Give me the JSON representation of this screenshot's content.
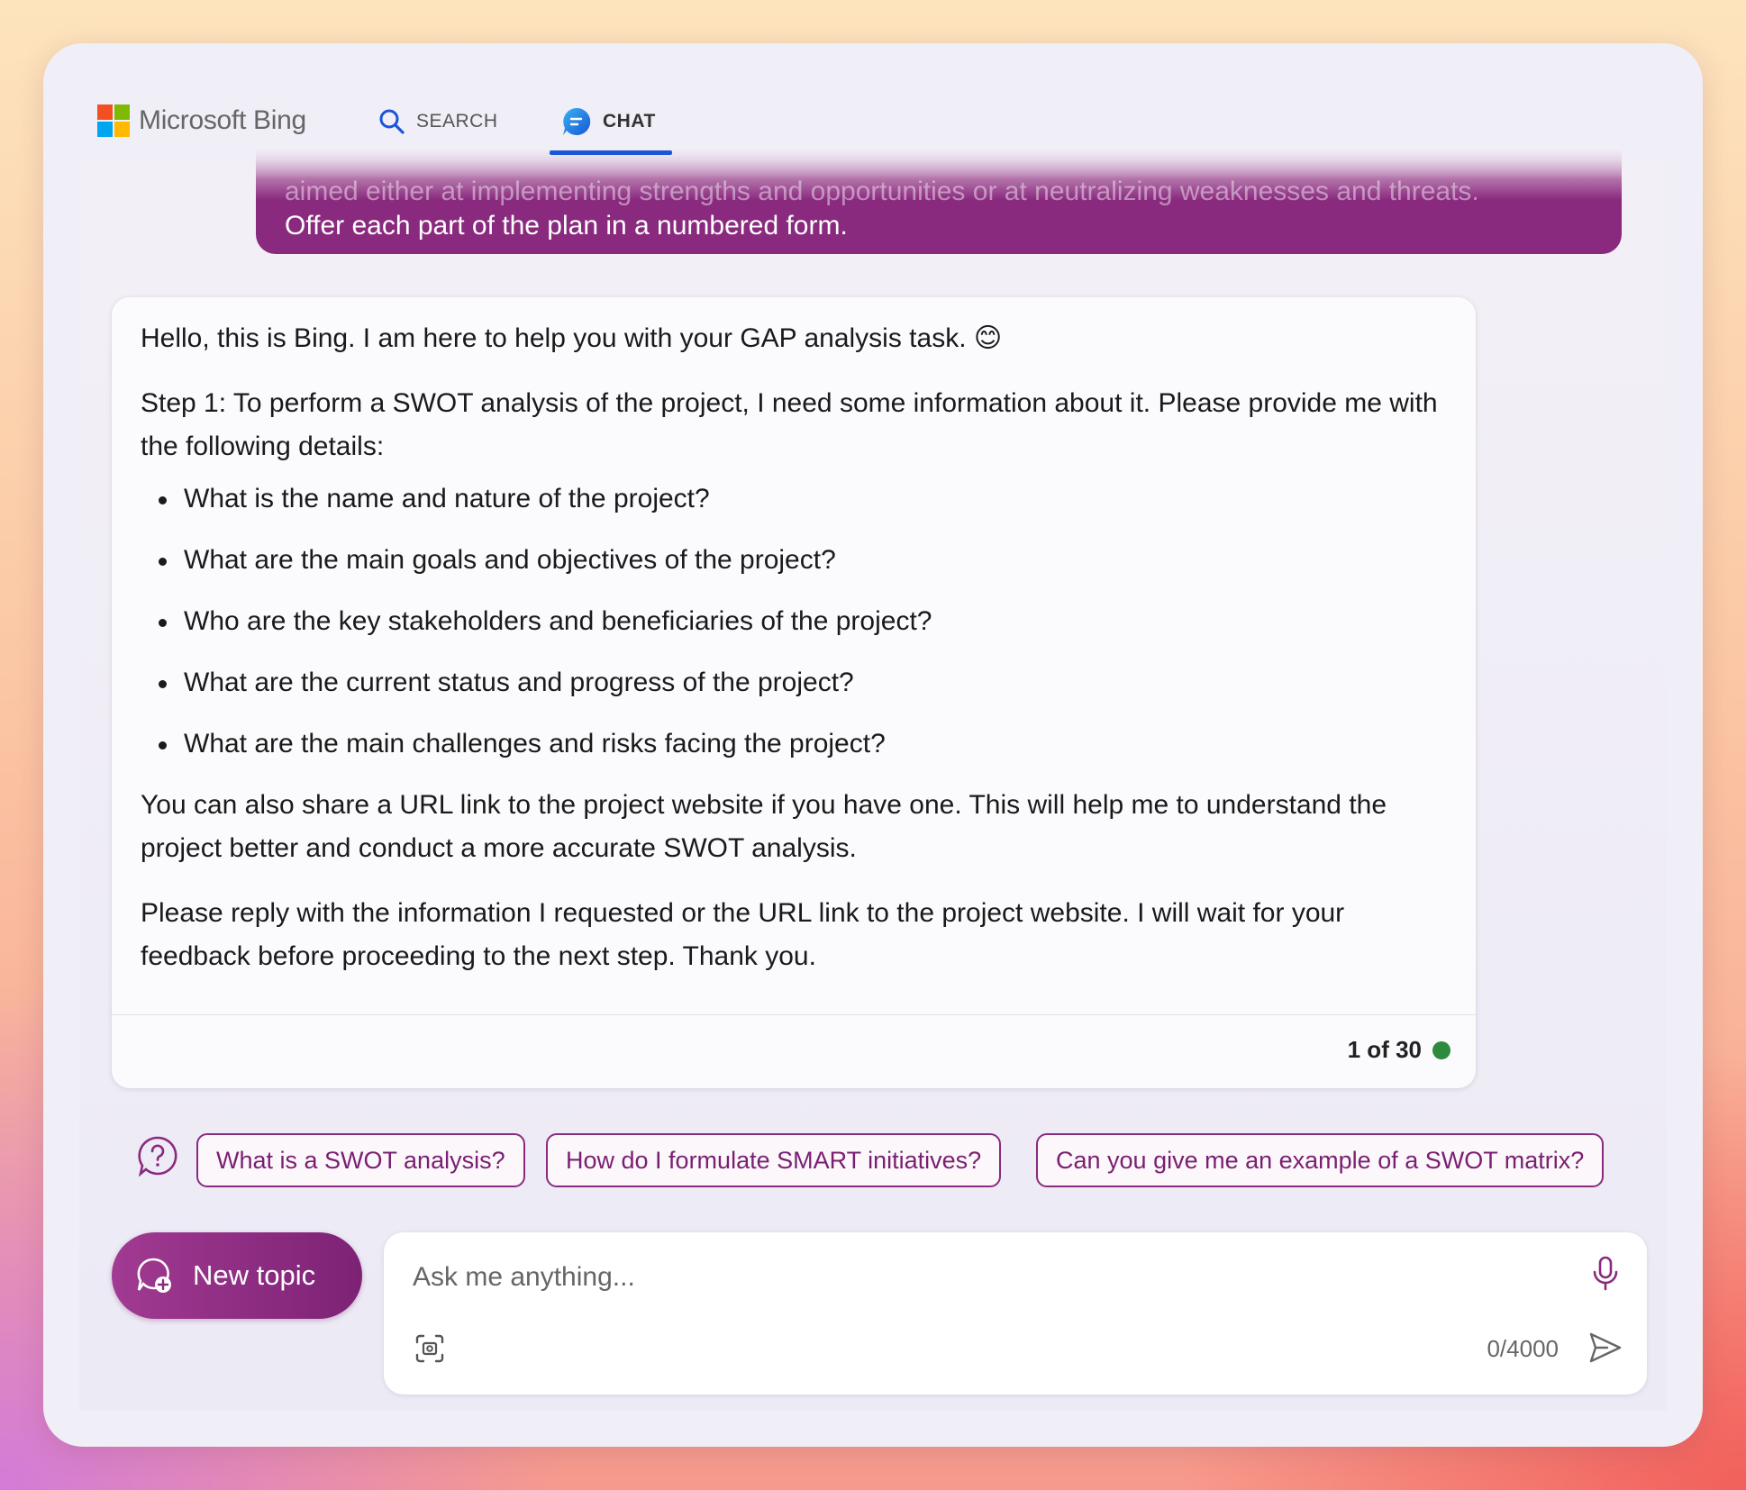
{
  "header": {
    "brand": "Microsoft Bing",
    "tabs": [
      {
        "label": "SEARCH",
        "icon": "search-icon",
        "active": false
      },
      {
        "label": "CHAT",
        "icon": "chat-icon",
        "active": true
      }
    ]
  },
  "user_message": {
    "faded_line": "aimed either at implementing strengths and opportunities or at neutralizing weaknesses and threats.",
    "visible_line": "Offer each part of the plan in a numbered form."
  },
  "bot_message": {
    "greeting": "Hello, this is Bing. I am here to help you with your GAP analysis task. 😊",
    "step1": "Step 1: To perform a SWOT analysis of the project, I need some information about it. Please provide me with the following details:",
    "questions": [
      "What is the name and nature of the project?",
      "What are the main goals and objectives of the project?",
      "Who are the key stakeholders and beneficiaries of the project?",
      "What are the current status and progress of the project?",
      "What are the main challenges and risks facing the project?"
    ],
    "url_note": "You can also share a URL link to the project website if you have one. This will help me to understand the project better and conduct a more accurate SWOT analysis.",
    "closing": "Please reply with the information I requested or the URL link to the project website. I will wait for your feedback before proceeding to the next step. Thank you.",
    "turn_counter": "1 of 30",
    "status_color": "#2e8b3e"
  },
  "suggestions": [
    "What is a SWOT analysis?",
    "How do I formulate SMART initiatives?",
    "Can you give me an example of a SWOT matrix?"
  ],
  "composer": {
    "new_topic_label": "New topic",
    "placeholder": "Ask me anything...",
    "value": "",
    "char_counter": "0/4000"
  },
  "colors": {
    "accent": "#8a2a7f",
    "tab_underline": "#1a55d8"
  }
}
